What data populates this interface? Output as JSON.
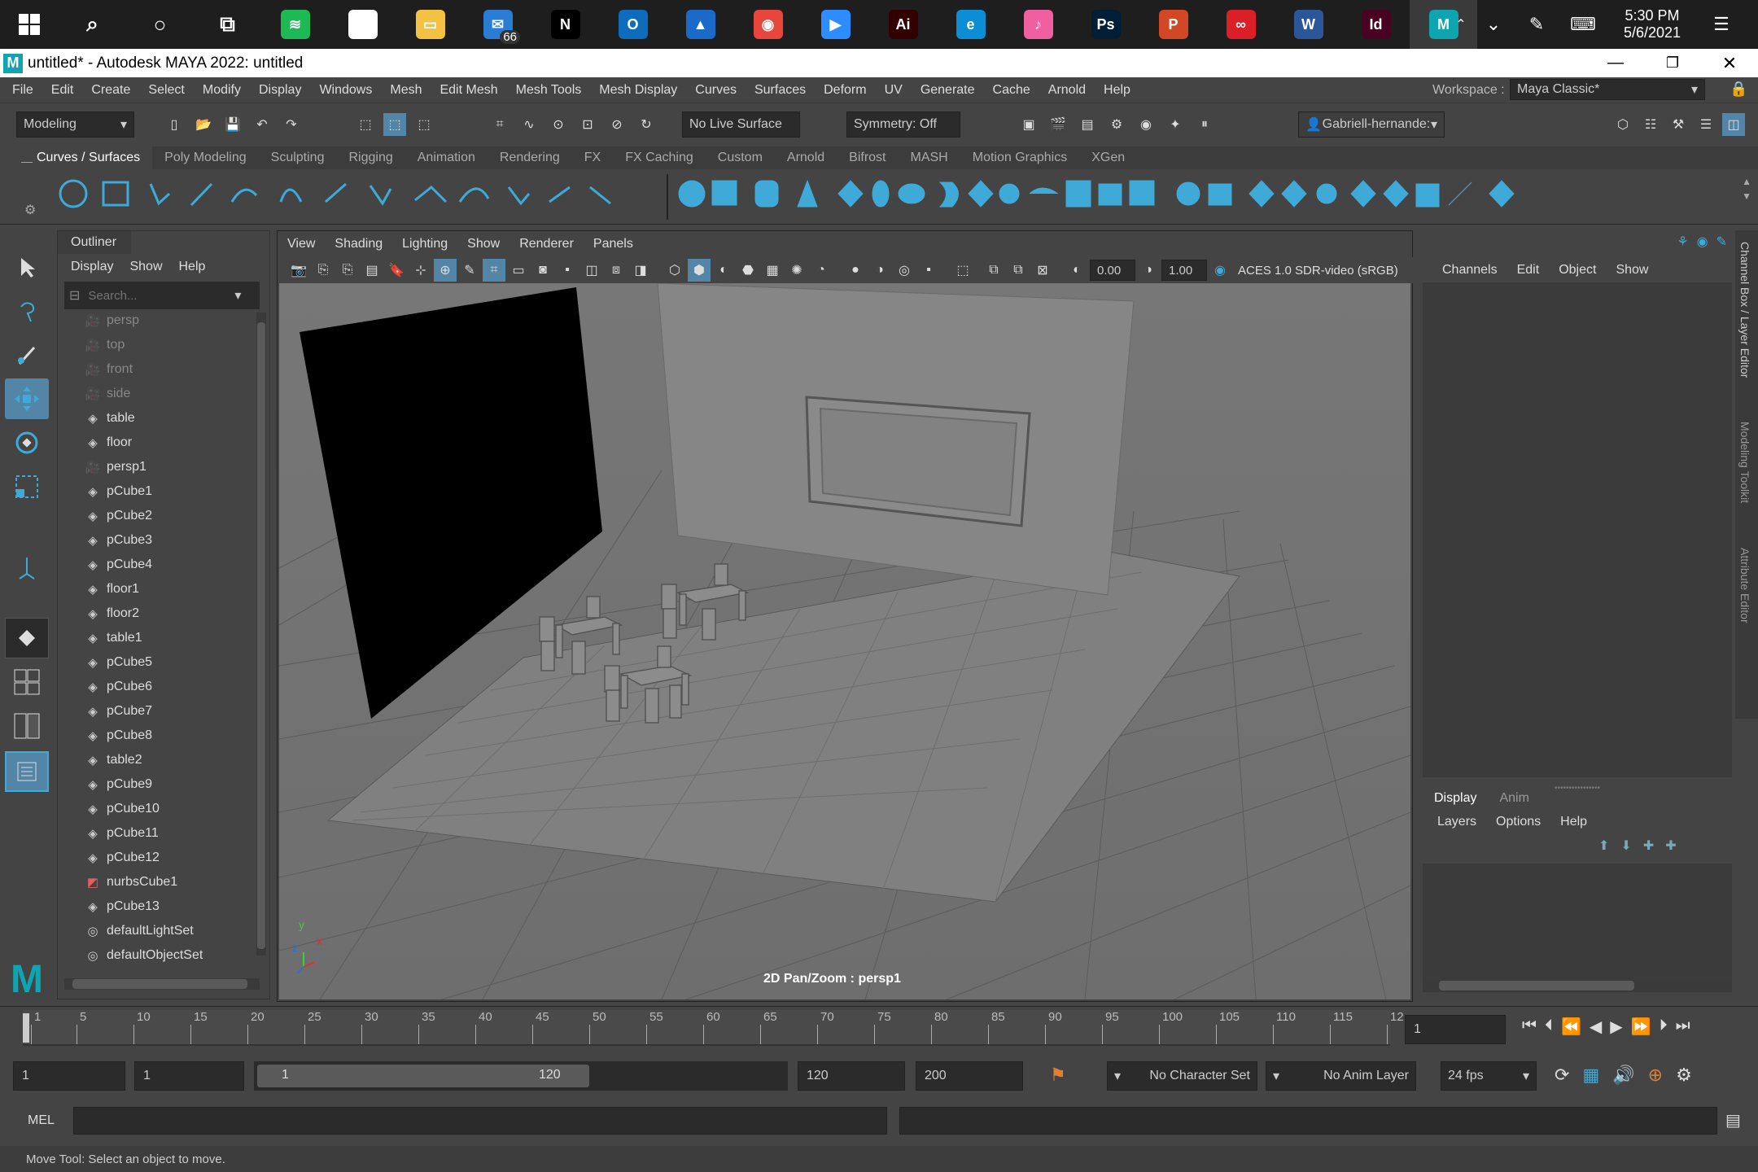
{
  "taskbar": {
    "apps": [
      {
        "name": "search-icon",
        "color": "#1e1e1e",
        "glyph": "⌕"
      },
      {
        "name": "cortana-icon",
        "color": "#1e1e1e",
        "glyph": "○"
      },
      {
        "name": "task-view-icon",
        "color": "#1e1e1e",
        "glyph": "⧉"
      },
      {
        "name": "spotify-icon",
        "color": "#1db954",
        "glyph": "≋"
      },
      {
        "name": "paint3d-icon",
        "color": "#ffffff",
        "glyph": "●"
      },
      {
        "name": "file-explorer-icon",
        "color": "#f4c242",
        "glyph": "▭"
      },
      {
        "name": "mail-icon",
        "color": "#2b7cd3",
        "glyph": "✉",
        "badge": "66"
      },
      {
        "name": "netflix-icon",
        "color": "#000000",
        "glyph": "N"
      },
      {
        "name": "outlook-icon",
        "color": "#0f6cbd",
        "glyph": "O"
      },
      {
        "name": "photos-icon",
        "color": "#1b6ac9",
        "glyph": "▲"
      },
      {
        "name": "chrome-icon",
        "color": "#e8453c",
        "glyph": "◉"
      },
      {
        "name": "zoom-icon",
        "color": "#2d8cff",
        "glyph": "▶"
      },
      {
        "name": "illustrator-icon",
        "color": "#330000",
        "glyph": "Ai"
      },
      {
        "name": "edge-icon",
        "color": "#0c8ed4",
        "glyph": "e"
      },
      {
        "name": "itunes-icon",
        "color": "#f05fa0",
        "glyph": "♪"
      },
      {
        "name": "photoshop-icon",
        "color": "#001e36",
        "glyph": "Ps"
      },
      {
        "name": "powerpoint-icon",
        "color": "#d24726",
        "glyph": "P"
      },
      {
        "name": "creative-cloud-icon",
        "color": "#da1f26",
        "glyph": "∞"
      },
      {
        "name": "word-icon",
        "color": "#2b579a",
        "glyph": "W"
      },
      {
        "name": "indesign-icon",
        "color": "#49021f",
        "glyph": "Id"
      },
      {
        "name": "maya-icon",
        "color": "#0ea5b0",
        "glyph": "M"
      }
    ],
    "time": "5:30 PM",
    "date": "5/6/2021"
  },
  "window": {
    "title": "untitled* - Autodesk MAYA 2022: untitled"
  },
  "menu": [
    "File",
    "Edit",
    "Create",
    "Select",
    "Modify",
    "Display",
    "Windows",
    "Mesh",
    "Edit Mesh",
    "Mesh Tools",
    "Mesh Display",
    "Curves",
    "Surfaces",
    "Deform",
    "UV",
    "Generate",
    "Cache",
    "Arnold",
    "Help"
  ],
  "workspace": {
    "label": "Workspace :",
    "value": "Maya Classic*"
  },
  "statusline": {
    "mode": "Modeling",
    "live_surface": "No Live Surface",
    "symmetry": "Symmetry: Off",
    "user": "Gabriell-hernande:"
  },
  "shelf_tabs": [
    "Curves / Surfaces",
    "Poly Modeling",
    "Sculpting",
    "Rigging",
    "Animation",
    "Rendering",
    "FX",
    "FX Caching",
    "Custom",
    "Arnold",
    "Bifrost",
    "MASH",
    "Motion Graphics",
    "XGen"
  ],
  "outliner": {
    "title": "Outliner",
    "menu": [
      "Display",
      "Show",
      "Help"
    ],
    "search_placeholder": "Search...",
    "items": [
      {
        "label": "persp",
        "type": "camera",
        "dim": true
      },
      {
        "label": "top",
        "type": "camera",
        "dim": true
      },
      {
        "label": "front",
        "type": "camera",
        "dim": true
      },
      {
        "label": "side",
        "type": "camera",
        "dim": true
      },
      {
        "label": "table",
        "type": "mesh",
        "dim": false
      },
      {
        "label": "floor",
        "type": "mesh",
        "dim": false
      },
      {
        "label": "persp1",
        "type": "camera",
        "dim": false
      },
      {
        "label": "pCube1",
        "type": "mesh",
        "dim": false
      },
      {
        "label": "pCube2",
        "type": "mesh",
        "dim": false
      },
      {
        "label": "pCube3",
        "type": "mesh",
        "dim": false
      },
      {
        "label": "pCube4",
        "type": "mesh",
        "dim": false
      },
      {
        "label": "floor1",
        "type": "mesh",
        "dim": false
      },
      {
        "label": "floor2",
        "type": "mesh",
        "dim": false
      },
      {
        "label": "table1",
        "type": "mesh",
        "dim": false
      },
      {
        "label": "pCube5",
        "type": "mesh",
        "dim": false
      },
      {
        "label": "pCube6",
        "type": "mesh",
        "dim": false
      },
      {
        "label": "pCube7",
        "type": "mesh",
        "dim": false
      },
      {
        "label": "pCube8",
        "type": "mesh",
        "dim": false
      },
      {
        "label": "table2",
        "type": "mesh",
        "dim": false
      },
      {
        "label": "pCube9",
        "type": "mesh",
        "dim": false
      },
      {
        "label": "pCube10",
        "type": "mesh",
        "dim": false
      },
      {
        "label": "pCube11",
        "type": "mesh",
        "dim": false
      },
      {
        "label": "pCube12",
        "type": "mesh",
        "dim": false
      },
      {
        "label": "nurbsCube1",
        "type": "nurbs",
        "dim": false
      },
      {
        "label": "pCube13",
        "type": "mesh",
        "dim": false
      },
      {
        "label": "defaultLightSet",
        "type": "set",
        "dim": false
      },
      {
        "label": "defaultObjectSet",
        "type": "set",
        "dim": false
      }
    ]
  },
  "viewport": {
    "menu": [
      "View",
      "Shading",
      "Lighting",
      "Show",
      "Renderer",
      "Panels"
    ],
    "exposure": "0.00",
    "gamma": "1.00",
    "colorspace": "ACES 1.0 SDR-video (sRGB)",
    "hud": "2D Pan/Zoom : persp1",
    "axis_y": "y",
    "axis_x": "x",
    "axis_z": "z"
  },
  "channelbox": {
    "menu": [
      "Channels",
      "Edit",
      "Object",
      "Show"
    ],
    "tabs": [
      "Display",
      "Anim"
    ],
    "layer_menu": [
      "Layers",
      "Options",
      "Help"
    ]
  },
  "sidetabs": [
    "Channel Box / Layer Editor",
    "Modeling Toolkit",
    "Attribute Editor"
  ],
  "timeline": {
    "ticks": [
      "1",
      "5",
      "10",
      "15",
      "20",
      "25",
      "30",
      "35",
      "40",
      "45",
      "50",
      "55",
      "60",
      "65",
      "70",
      "75",
      "80",
      "85",
      "90",
      "95",
      "100",
      "105",
      "110",
      "115",
      "12"
    ],
    "current_frame": "1"
  },
  "range": {
    "start": "1",
    "playback_start": "1",
    "slider_start": "1",
    "slider_end": "120",
    "playback_end": "120",
    "end": "200",
    "character_set": "No Character Set",
    "anim_layer": "No Anim Layer",
    "fps": "24 fps"
  },
  "mel": {
    "label": "MEL"
  },
  "help_line": "Move Tool: Select an object to move."
}
